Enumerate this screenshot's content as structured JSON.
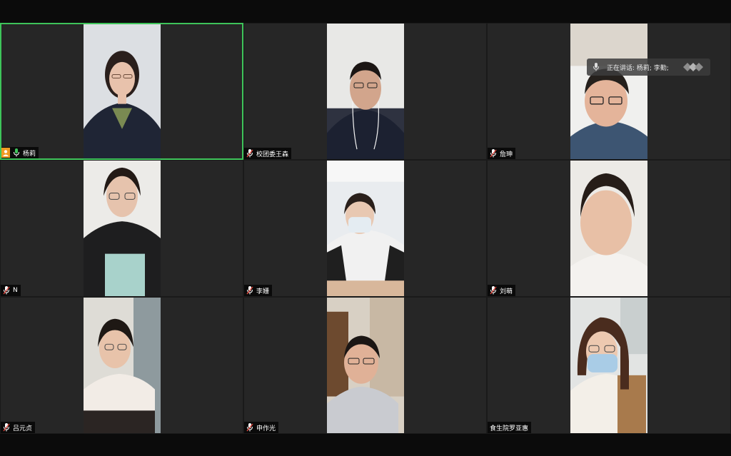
{
  "speaking_banner": {
    "label": "正在讲话: 杨莉; 李勤;"
  },
  "participants": [
    {
      "name": "杨莉",
      "muted": false,
      "host": true,
      "active": true
    },
    {
      "name": "校团委王森",
      "muted": true
    },
    {
      "name": "詹珅",
      "muted": true
    },
    {
      "name": "N",
      "muted": true
    },
    {
      "name": "李姗",
      "muted": true
    },
    {
      "name": "刘萌",
      "muted": true
    },
    {
      "name": "吕元贞",
      "muted": true
    },
    {
      "name": "申作光",
      "muted": true
    },
    {
      "name": "食生院罗亚惠",
      "muted": false
    }
  ],
  "colors": {
    "active_border": "#3ec45a",
    "host_badge": "#f09a22",
    "tile_bg": "#262626"
  }
}
